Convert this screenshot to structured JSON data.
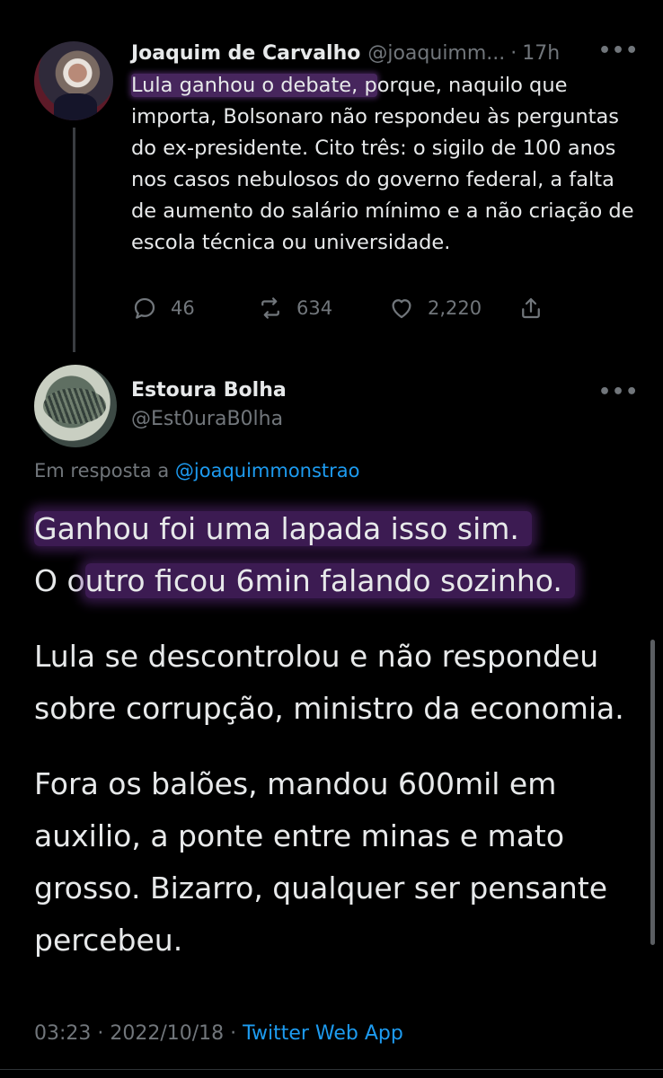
{
  "parent_tweet": {
    "author_name": "Joaquim de Carvalho",
    "handle": "@joaquimm...",
    "separator": "·",
    "time": "17h",
    "text_highlighted": "Lula ganhou o debate, p",
    "text_rest": "orque, naquilo que importa, Bolsonaro não respondeu às perguntas do ex-presidente. Cito três: o sigilo de 100 anos nos casos nebulosos do governo federal, a falta de aumento do salário mínimo e a não criação de escola técnica ou universidade.",
    "replies": "46",
    "retweets": "634",
    "likes": "2,220"
  },
  "reply_tweet": {
    "author_name": "Estoura Bolha",
    "handle": "@Est0uraB0lha",
    "reply_prefix": "Em resposta a",
    "reply_to_handle": "@joaquimmonstrao",
    "line1": "Ganhou foi uma lapada isso sim.",
    "line2_plain": "O o",
    "line2_highlighted": "utro ficou  6min falando sozinho.",
    "paragraph2": "Lula se descontrolou e não respondeu sobre corrupção, ministro da economia.",
    "paragraph3": "Fora os balões, mandou 600mil em auxilio, a ponte entre minas e mato grosso. Bizarro, qualquer ser pensante percebeu.",
    "timestamp": "03:23 · 2022/10/18 ·",
    "source_app": "Twitter Web App"
  },
  "more_icon_label": "•••",
  "colors": {
    "background": "#000000",
    "text": "#e7e9ea",
    "secondary": "#71767b",
    "link": "#1d9bf0",
    "highlight": "#8246aa"
  }
}
